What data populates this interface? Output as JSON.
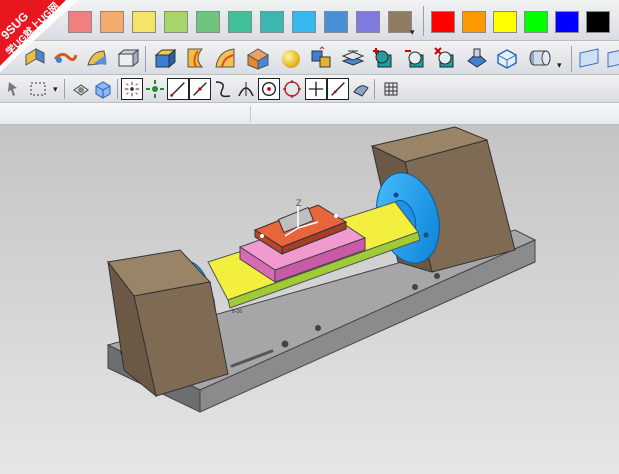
{
  "logo": {
    "brand": "9SUG",
    "slogan": "学UG就上UG网",
    "color": "#e8171f"
  },
  "colors": {
    "faded_palette": [
      "#f07f7f",
      "#f4ac6e",
      "#f5e46a",
      "#a8d66a",
      "#6fc47d",
      "#3fbf9a",
      "#39b8b2",
      "#37b7ef",
      "#4a8fd6",
      "#7e7be0",
      "#907c60"
    ],
    "solid_palette": [
      "#ff0000",
      "#ff9900",
      "#ffff00",
      "#00ff00",
      "#0000ff",
      "#000000"
    ]
  },
  "toolbar2": {
    "icons": [
      "extrude-sheet-icon",
      "swept-surface-icon",
      "surface-icon",
      "box-icon",
      "block-icon",
      "revolve-icon",
      "surface-patch-icon",
      "sheet-body-icon",
      "sphere-icon",
      "assembly-icon",
      "layers-icon",
      "add-body-icon",
      "subtract-body-icon",
      "remove-body-icon",
      "hide-body-icon",
      "wireframe-icon",
      "cylinder-icon",
      "plane-icon",
      "extra-icon"
    ]
  },
  "toolbar3": {
    "icons": [
      "snap-icon",
      "selection-box-icon",
      "view-3d-icon",
      "view-box-icon",
      "move-points-icon",
      "drag-icon",
      "line-icon",
      "curve-icon",
      "bend-icon",
      "arc-icon",
      "circle-point-icon",
      "circle-icon",
      "cross-icon",
      "slash-icon",
      "shade-icon",
      "grid-icon"
    ]
  },
  "viewport": {
    "axis_label": "Z",
    "model_part_label": "8-16"
  }
}
